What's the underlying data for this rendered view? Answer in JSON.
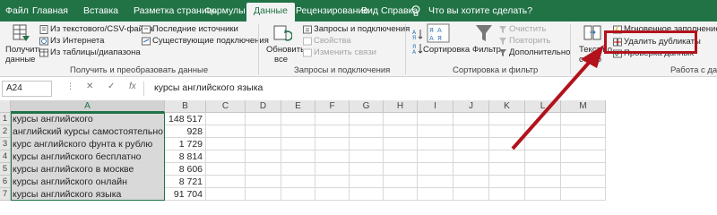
{
  "tabs": [
    {
      "label": "Файл",
      "active": false
    },
    {
      "label": "Главная",
      "active": false
    },
    {
      "label": "Вставка",
      "active": false
    },
    {
      "label": "Разметка страницы",
      "active": false
    },
    {
      "label": "Формулы",
      "active": false
    },
    {
      "label": "Данные",
      "active": true
    },
    {
      "label": "Рецензирование",
      "active": false
    },
    {
      "label": "Вид",
      "active": false
    },
    {
      "label": "Справка",
      "active": false
    }
  ],
  "tell_me": "Что вы хотите сделать?",
  "ribbon": {
    "get_data": {
      "get_data_label_1": "Получить",
      "get_data_label_2": "данные",
      "from_text_csv": "Из текстового/CSV-файла",
      "from_web": "Из Интернета",
      "from_table": "Из таблицы/диапазона",
      "recent_sources": "Последние источники",
      "existing_connections": "Существующие подключения",
      "group_label": "Получить и преобразовать данные"
    },
    "queries": {
      "refresh_all_1": "Обновить",
      "refresh_all_2": "все",
      "queries_connections": "Запросы и подключения",
      "properties": "Свойства",
      "edit_links": "Изменить связи",
      "group_label": "Запросы и подключения"
    },
    "sort_filter": {
      "sort": "Сортировка",
      "filter": "Фильтр",
      "clear": "Очистить",
      "reapply": "Повторить",
      "advanced": "Дополнительно",
      "group_label": "Сортировка и фильтр"
    },
    "data_tools": {
      "text_to_columns_1": "Текст по",
      "text_to_columns_2": "столб",
      "flash_fill": "Мгновенное заполнение",
      "remove_duplicates": "Удалить дубликаты",
      "data_validation": "Проверка данных",
      "group_label": "Работа с данн"
    }
  },
  "formula_bar": {
    "name_box": "A24",
    "cancel": "✕",
    "enter": "✓",
    "fx": "fx",
    "content": "курсы английского языка"
  },
  "columns": [
    "A",
    "B",
    "C",
    "D",
    "E",
    "F",
    "G",
    "H",
    "I",
    "J",
    "K",
    "L",
    "M"
  ],
  "rows": [
    {
      "num": "1",
      "a": "курсы английского",
      "b": "148 517"
    },
    {
      "num": "2",
      "a": "английский курсы самостоятельно",
      "b": "928"
    },
    {
      "num": "3",
      "a": "курс английского фунта к рублю",
      "b": "1 729"
    },
    {
      "num": "4",
      "a": "курсы английского бесплатно",
      "b": "8 814"
    },
    {
      "num": "5",
      "a": "курсы английского в москве",
      "b": "8 606"
    },
    {
      "num": "6",
      "a": "курсы английского онлайн",
      "b": "8 721"
    },
    {
      "num": "7",
      "a": "курсы английского языка",
      "b": "91 704"
    }
  ],
  "colors": {
    "excel_green": "#217346",
    "highlight_red": "#b3121c",
    "selected_cell_bg": "#d9d9d9"
  }
}
